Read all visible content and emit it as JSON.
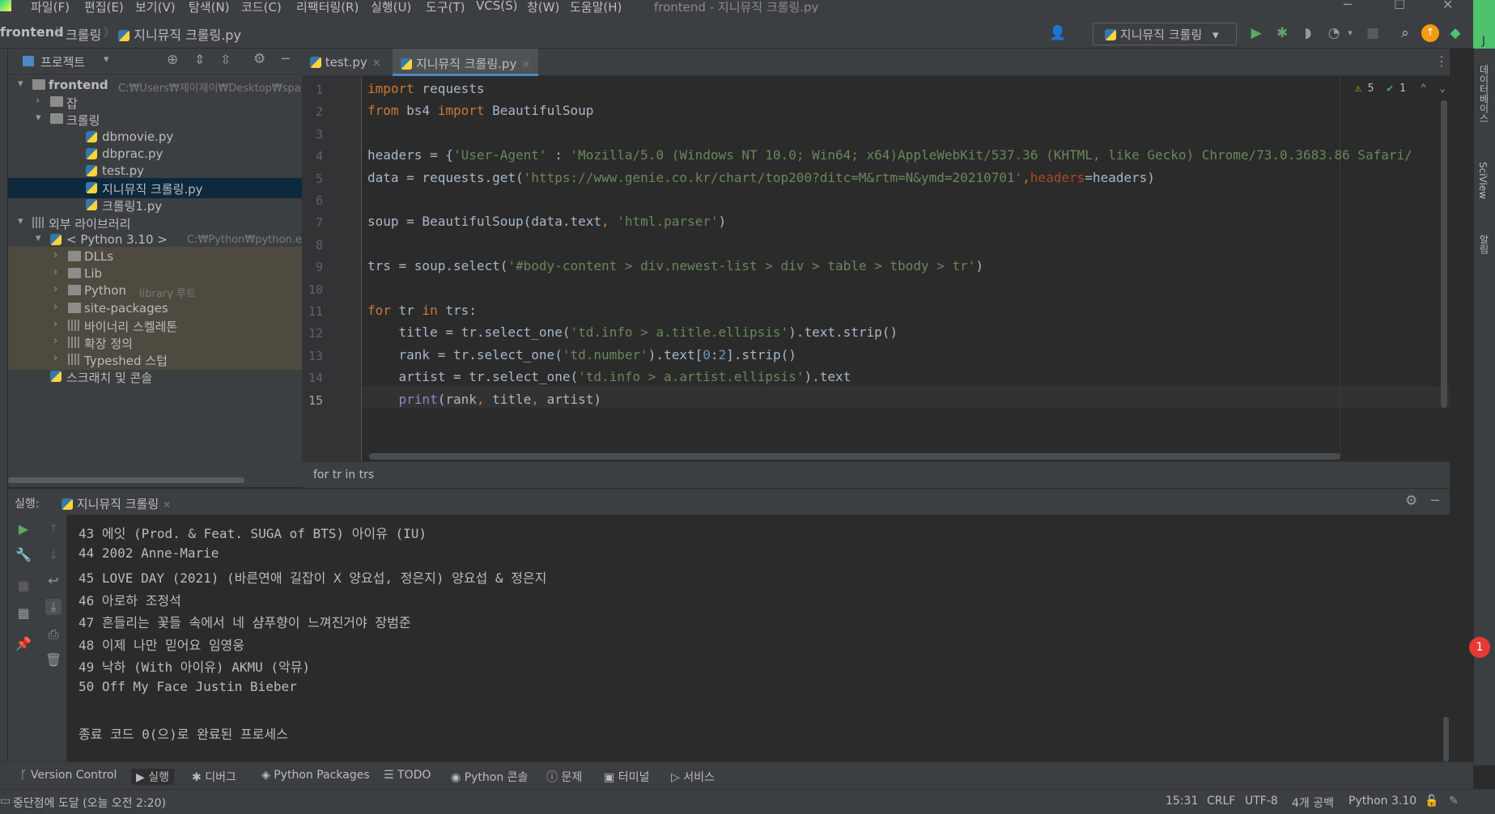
{
  "menu": {
    "items": [
      "파일(F)",
      "편집(E)",
      "보기(V)",
      "탐색(N)",
      "코드(C)",
      "리팩터링(R)",
      "실행(U)",
      "도구(T)",
      "VCS(S)",
      "창(W)",
      "도움말(H)"
    ],
    "window_title": "frontend - 지니뮤직 크롤링.py"
  },
  "breadcrumb": {
    "project": "frontend",
    "folder": "크롤링",
    "file": "지니뮤직 크롤링.py"
  },
  "run_config": {
    "label": "지니뮤직 크롤링"
  },
  "project_panel": {
    "title": "프로젝트",
    "tree": [
      {
        "label": "frontend",
        "hint": "C:₩Users₩제이제이₩Desktop₩spar",
        "arrow": "▾",
        "icon": "folder",
        "indent": 0
      },
      {
        "label": "잡",
        "hint": "",
        "arrow": "›",
        "icon": "folder",
        "indent": 1
      },
      {
        "label": "크롤링",
        "hint": "",
        "arrow": "▾",
        "icon": "folder",
        "indent": 1
      },
      {
        "label": "dbmovie.py",
        "hint": "",
        "arrow": "",
        "icon": "python-file",
        "indent": 3
      },
      {
        "label": "dbprac.py",
        "hint": "",
        "arrow": "",
        "icon": "python-file",
        "indent": 3
      },
      {
        "label": "test.py",
        "hint": "",
        "arrow": "",
        "icon": "python-file",
        "indent": 3
      },
      {
        "label": "지니뮤직 크롤링.py",
        "hint": "",
        "arrow": "",
        "icon": "python-file",
        "indent": 3
      },
      {
        "label": "크롤링1.py",
        "hint": "",
        "arrow": "",
        "icon": "python-file",
        "indent": 3
      },
      {
        "label": "외부 라이브러리",
        "hint": "",
        "arrow": "▾",
        "icon": "library",
        "indent": 0
      },
      {
        "label": "< Python 3.10 >",
        "hint": "C:₩Python₩python.exe",
        "arrow": "▾",
        "icon": "python-sdk",
        "indent": 1
      },
      {
        "label": "DLLs",
        "hint": "",
        "arrow": "›",
        "icon": "folder",
        "indent": 2
      },
      {
        "label": "Lib",
        "hint": "",
        "arrow": "›",
        "icon": "folder",
        "indent": 2
      },
      {
        "label": "Python",
        "hint": "library 루트",
        "arrow": "›",
        "icon": "folder",
        "indent": 2
      },
      {
        "label": "site-packages",
        "hint": "",
        "arrow": "›",
        "icon": "folder",
        "indent": 2
      },
      {
        "label": "바이너리 스켈레톤",
        "hint": "",
        "arrow": "›",
        "icon": "library",
        "indent": 2
      },
      {
        "label": "확장 정의",
        "hint": "",
        "arrow": "›",
        "icon": "library",
        "indent": 2
      },
      {
        "label": "Typeshed 스텁",
        "hint": "",
        "arrow": "›",
        "icon": "library",
        "indent": 2
      },
      {
        "label": "스크래치 및 콘솔",
        "hint": "",
        "arrow": "",
        "icon": "scratch",
        "indent": 1
      }
    ]
  },
  "editor": {
    "tabs": [
      {
        "label": "test.py",
        "active": false
      },
      {
        "label": "지니뮤직 크롤링.py",
        "active": true
      }
    ],
    "inspections": {
      "warnings": "5",
      "ok": "1"
    },
    "footer": "for tr in trs",
    "line_numbers": [
      "1",
      "2",
      "3",
      "4",
      "5",
      "6",
      "7",
      "8",
      "9",
      "10",
      "11",
      "12",
      "13",
      "14",
      "15"
    ],
    "lines": [
      "import requests",
      "from bs4 import BeautifulSoup",
      "",
      "headers = {'User-Agent' : 'Mozilla/5.0 (Windows NT 10.0; Win64; x64)AppleWebKit/537.36 (KHTML, like Gecko) Chrome/73.0.3683.86 Safari/",
      "data = requests.get('https://www.genie.co.kr/chart/top200?ditc=M&rtm=N&ymd=20210701',headers=headers)",
      "",
      "soup = BeautifulSoup(data.text, 'html.parser')",
      "",
      "trs = soup.select('#body-content > div.newest-list > div > table > tbody > tr')",
      "",
      "for tr in trs:",
      "    title = tr.select_one('td.info > a.title.ellipsis').text.strip()",
      "    rank = tr.select_one('td.number').text[0:2].strip()",
      "    artist = tr.select_one('td.info > a.artist.ellipsis').text",
      "    print(rank, title, artist)"
    ]
  },
  "run_panel": {
    "label": "실행:",
    "tab": "지니뮤직 크롤링",
    "output": [
      "43 에잇 (Prod. & Feat. SUGA of BTS) 아이유 (IU)",
      "44 2002 Anne-Marie",
      "45 LOVE DAY (2021) (바른연애 길잡이 X 양요섭, 정은지) 양요섭 & 정은지",
      "46 아로하 조정석",
      "47 흔들리는 꽃들 속에서 네 샴푸향이 느껴진거야 장범준",
      "48 이제 나만 믿어요 임영웅",
      "49 낙하 (With 아이유) AKMU (악뮤)",
      "50 Off My Face Justin Bieber",
      "",
      "종료 코드 0(으)로 완료된 프로세스"
    ]
  },
  "bottom_tabs": [
    {
      "label": "Version Control",
      "icon": "branch-icon"
    },
    {
      "label": "실행",
      "icon": "run-icon"
    },
    {
      "label": "디버그",
      "icon": "bug-icon"
    },
    {
      "label": "Python Packages",
      "icon": "packages-icon"
    },
    {
      "label": "TODO",
      "icon": "list-icon"
    },
    {
      "label": "Python 콘솔",
      "icon": "python-icon"
    },
    {
      "label": "문제",
      "icon": "info-icon"
    },
    {
      "label": "터미널",
      "icon": "terminal-icon"
    },
    {
      "label": "서비스",
      "icon": "services-icon"
    }
  ],
  "status_bar": {
    "message": "중단점에 도달 (오늘 오전 2:20)",
    "position": "15:31",
    "line_sep": "CRLF",
    "encoding": "UTF-8",
    "indent": "4개 공백",
    "interpreter": "Python 3.10"
  },
  "right_strip": {
    "database": "데이터베이스",
    "sciview": "SciView",
    "notifications": "알림",
    "badge": "1"
  },
  "colors": {
    "bg": "#2b2b2b",
    "panel": "#3c3f41",
    "keyword": "#cc7832",
    "string": "#6a8759",
    "accent": "#4a88c7"
  }
}
